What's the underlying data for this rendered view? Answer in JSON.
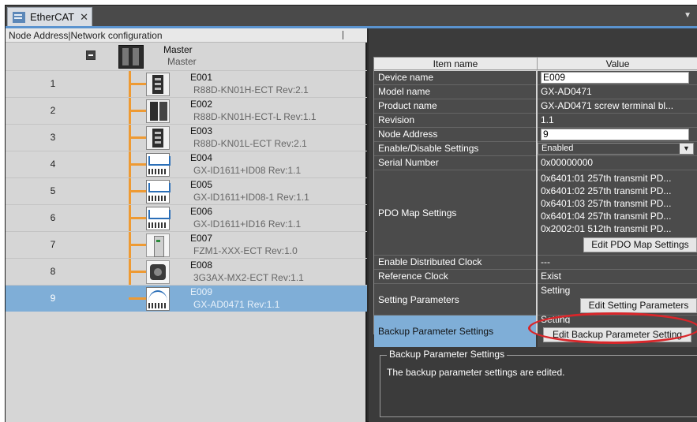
{
  "tab": {
    "title": "EtherCAT",
    "close": "✕"
  },
  "left": {
    "header": "Node Address|Network configuration",
    "master": {
      "name": "Master",
      "sub": "Master"
    },
    "nodes": [
      {
        "num": "1",
        "name": "E001",
        "model": "R88D-KN01H-ECT Rev:2.1"
      },
      {
        "num": "2",
        "name": "E002",
        "model": "R88D-KN01H-ECT-L Rev:1.1"
      },
      {
        "num": "3",
        "name": "E003",
        "model": "R88D-KN01L-ECT Rev:2.1"
      },
      {
        "num": "4",
        "name": "E004",
        "model": "GX-ID1611+ID08 Rev:1.1"
      },
      {
        "num": "5",
        "name": "E005",
        "model": "GX-ID1611+ID08-1 Rev:1.1"
      },
      {
        "num": "6",
        "name": "E006",
        "model": "GX-ID1611+ID16 Rev:1.1"
      },
      {
        "num": "7",
        "name": "E007",
        "model": "FZM1-XXX-ECT Rev:1.0"
      },
      {
        "num": "8",
        "name": "E008",
        "model": "3G3AX-MX2-ECT Rev:1.1"
      },
      {
        "num": "9",
        "name": "E009",
        "model": "GX-AD0471 Rev:1.1"
      }
    ]
  },
  "table": {
    "col_item": "Item name",
    "col_value": "Value",
    "device_name": {
      "label": "Device name",
      "value": "E009"
    },
    "model_name": {
      "label": "Model name",
      "value": "GX-AD0471"
    },
    "product_name": {
      "label": "Product name",
      "value": "GX-AD0471 screw terminal bl..."
    },
    "revision": {
      "label": "Revision",
      "value": "1.1"
    },
    "node_address": {
      "label": "Node Address",
      "value": "9"
    },
    "enable_disable": {
      "label": "Enable/Disable Settings",
      "value": "Enabled"
    },
    "serial": {
      "label": "Serial Number",
      "value": "0x00000000"
    },
    "pdo": {
      "label": "PDO Map Settings",
      "values": [
        "0x6401:01 257th transmit PD...",
        "0x6401:02 257th transmit PD...",
        "0x6401:03 257th transmit PD...",
        "0x6401:04 257th transmit PD...",
        "0x2002:01 512th transmit PD..."
      ],
      "button": "Edit PDO Map Settings"
    },
    "dist_clock": {
      "label": "Enable Distributed Clock",
      "value": "---"
    },
    "ref_clock": {
      "label": "Reference Clock",
      "value": "Exist"
    },
    "setting_params": {
      "label": "Setting Parameters",
      "value": "Setting",
      "button": "Edit Setting Parameters"
    },
    "backup_params": {
      "label": "Backup Parameter Settings",
      "value": "Setting",
      "button": "Edit Backup Parameter Setting"
    }
  },
  "description": {
    "title": "Backup Parameter Settings",
    "text": "The backup parameter settings are edited."
  },
  "colors": {
    "selection": "#7faed7",
    "wire": "#ee9a33",
    "highlight_ellipse": "#d9262a",
    "accent": "#5a93cf"
  }
}
